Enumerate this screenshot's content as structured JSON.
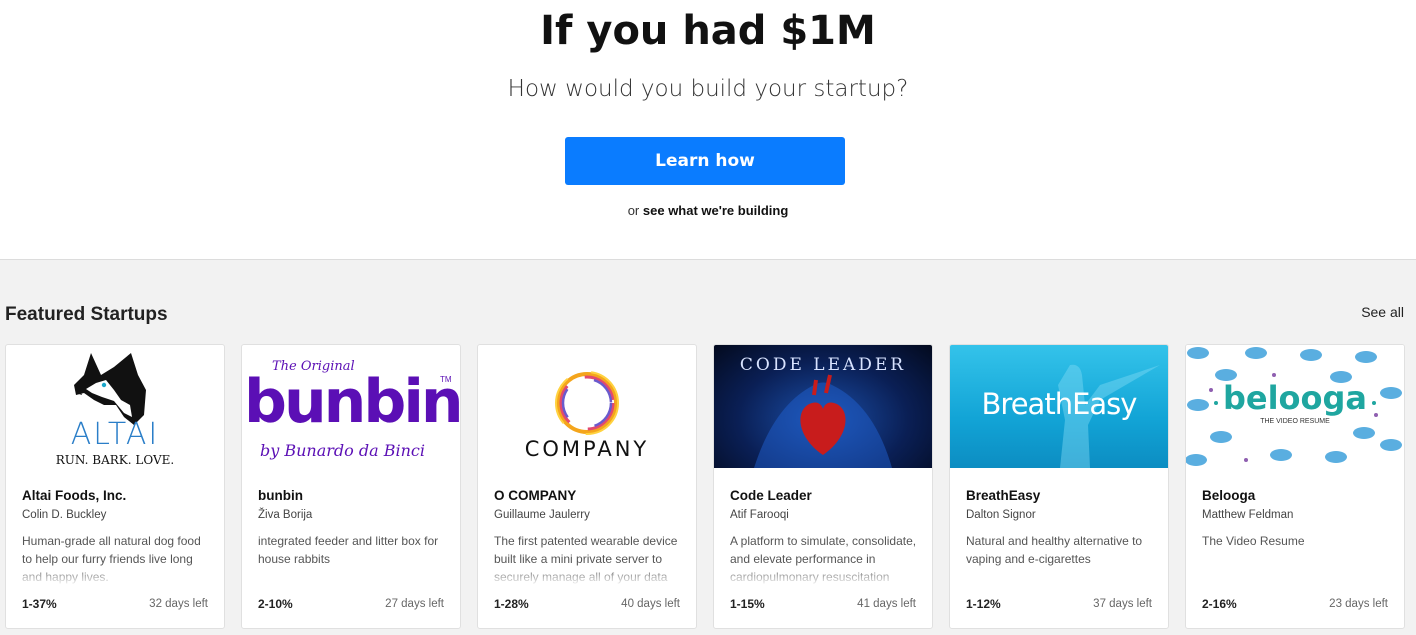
{
  "hero": {
    "title": "If you had $1M",
    "subtitle": "How would you build your startup?",
    "cta_label": "Learn how",
    "alt_prefix": "or",
    "alt_link": "see what we're building"
  },
  "featured": {
    "title": "Featured Startups",
    "see_all": "See all"
  },
  "colors": {
    "cta": "#0a7cff",
    "bunbin_purple": "#5b0fb5",
    "altai_blue": "#2a7ec8",
    "belooga_teal": "#1fa6a0"
  },
  "cards": [
    {
      "name": "Altai Foods, Inc.",
      "founder": "Colin D. Buckley",
      "description": "Human-grade all natural dog food to help our furry friends live long and happy lives.",
      "equity": "1-37%",
      "days_left": "32 days left",
      "logo": {
        "icon": "husky-dog-icon",
        "wordmark": "ALTAI",
        "tagline": "RUN. BARK. LOVE."
      }
    },
    {
      "name": "bunbin",
      "founder": "Živa Borija",
      "description": "integrated feeder and litter box for house rabbits",
      "equity": "2-10%",
      "days_left": "27 days left",
      "logo": {
        "top": "The Original",
        "wordmark": "bunbin",
        "tm": "TM",
        "bottom": "by Bunardo da Binci"
      }
    },
    {
      "name": "O COMPANY",
      "founder": "Guillaume Jaulerry",
      "description": "The first patented wearable device built like a mini private server to securely manage all of your data",
      "equity": "1-28%",
      "days_left": "40 days left",
      "logo": {
        "icon": "rainbow-ring-icon",
        "wordmark": "COMPANY"
      }
    },
    {
      "name": "Code Leader",
      "founder": "Atif Farooqi",
      "description": "A platform to simulate, consolidate, and elevate performance in cardiopulmonary resuscitation",
      "equity": "1-15%",
      "days_left": "41 days left",
      "logo": {
        "icon": "heart-icon",
        "wordmark": "CODE LEADER"
      }
    },
    {
      "name": "BreathEasy",
      "founder": "Dalton Signor",
      "description": " Natural and healthy alternative to vaping and e-cigarettes",
      "equity": "1-12%",
      "days_left": "37 days left",
      "logo": {
        "wordmark": "BreathEasy"
      }
    },
    {
      "name": "Belooga",
      "founder": "Matthew Feldman",
      "description": "The Video Resume",
      "equity": "2-16%",
      "days_left": "23 days left",
      "logo": {
        "icon": "beluga-whale-icon",
        "wordmark": "belooga",
        "tagline": "THE VIDEO RESUME"
      }
    }
  ]
}
